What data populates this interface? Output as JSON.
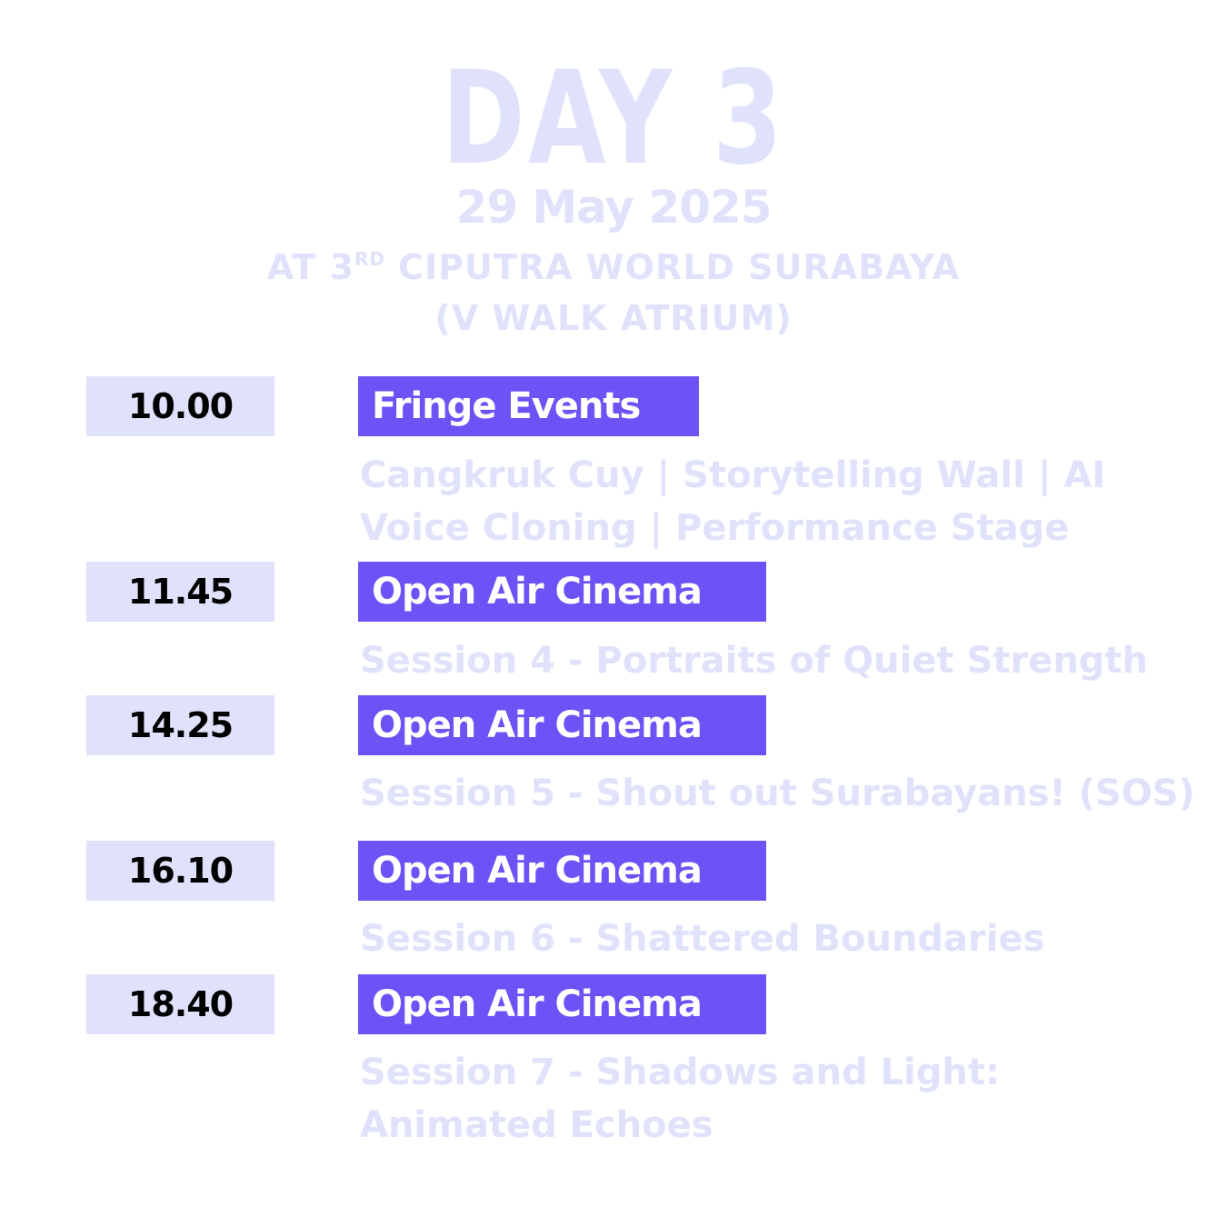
{
  "header": {
    "title": "DAY 3",
    "date": "29 May 2025",
    "venue_prefix": "AT 3",
    "venue_superscript": "RD",
    "venue_suffix": " CIPUTRA WORLD SURABAYA",
    "venue_line2": "(V WALK ATRIUM)"
  },
  "colors": {
    "accent": "#6d52f5",
    "pale": "#e0e2fb",
    "time_text": "#000000"
  },
  "schedule": [
    {
      "time": "10.00",
      "event": "Fringe Events",
      "description": [
        "Cangkruk Cuy | Storytelling Wall | AI",
        "Voice Cloning | Performance Stage"
      ]
    },
    {
      "time": "11.45",
      "event": "Open Air Cinema",
      "description": [
        "Session 4 - Portraits of Quiet Strength"
      ]
    },
    {
      "time": "14.25",
      "event": "Open Air Cinema",
      "description": [
        "Session 5 - Shout out Surabayans! (SOS)"
      ]
    },
    {
      "time": "16.10",
      "event": "Open Air Cinema",
      "description": [
        "Session 6 - Shattered Boundaries"
      ]
    },
    {
      "time": "18.40",
      "event": "Open Air Cinema",
      "description": [
        "Session 7 - Shadows and Light:",
        "Animated Echoes"
      ]
    }
  ]
}
